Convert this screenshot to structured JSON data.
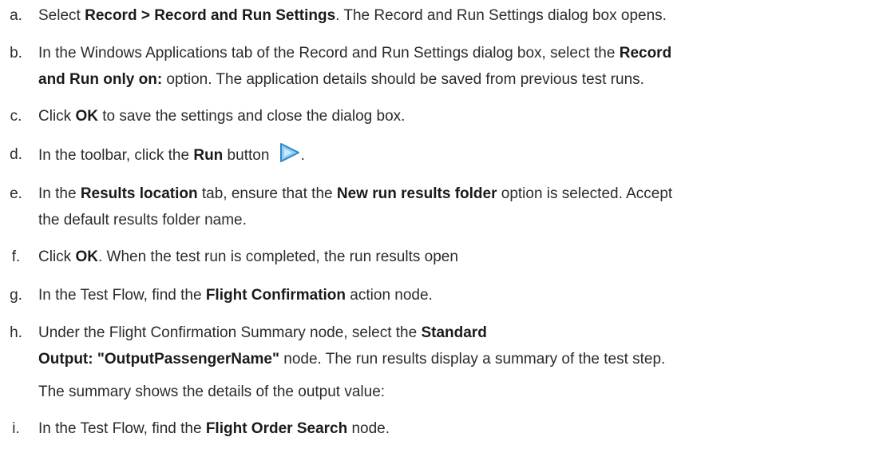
{
  "steps": [
    {
      "letter": "a.",
      "lines": [
        [
          "Select ",
          {
            "b": "Record > Record and Run Settings"
          },
          ". The Record and Run Settings dialog box opens."
        ]
      ]
    },
    {
      "letter": "b.",
      "lines": [
        [
          "In the Windows Applications tab of the Record and Run Settings dialog box, select the ",
          {
            "b": "Record"
          }
        ],
        [
          {
            "b": "and Run only on:"
          },
          " option. The application details should be saved from previous test runs."
        ]
      ]
    },
    {
      "letter": "c.",
      "lines": [
        [
          "Click ",
          {
            "b": "OK"
          },
          " to save the settings and close the dialog box."
        ]
      ]
    },
    {
      "letter": "d.",
      "lines": [
        [
          "In the toolbar, click the ",
          {
            "b": "Run"
          },
          " button ",
          {
            "icon": "run-icon"
          },
          "."
        ]
      ]
    },
    {
      "letter": "e.",
      "lines": [
        [
          "In the ",
          {
            "b": "Results location"
          },
          " tab, ensure that the ",
          {
            "b": "New run results folder"
          },
          " option is selected. Accept"
        ],
        [
          "the default results folder name."
        ]
      ]
    },
    {
      "letter": "f.",
      "lines": [
        [
          "Click ",
          {
            "b": "OK"
          },
          ". When the test run is completed, the run results open"
        ]
      ]
    },
    {
      "letter": "g.",
      "lines": [
        [
          "In the Test Flow, find the ",
          {
            "b": "Flight Confirmation"
          },
          " action node."
        ]
      ]
    },
    {
      "letter": "h.",
      "lines": [
        [
          "Under the Flight Confirmation Summary node, select the ",
          {
            "b": "Standard"
          }
        ],
        [
          {
            "b": "Output: \"OutputPassengerName\""
          },
          " node. The run results display a summary of the test step."
        ],
        [
          "The summary shows the details of the output value:"
        ]
      ]
    },
    {
      "letter": "i.",
      "lines": [
        [
          "In the Test Flow, find the ",
          {
            "b": "Flight Order Search"
          },
          " node."
        ]
      ]
    }
  ],
  "icons": {
    "run_button": "run-icon",
    "colors": {
      "icon_fill": "#8fd0f5",
      "icon_stroke": "#2f86c8",
      "text": "#2b2b2b"
    }
  }
}
